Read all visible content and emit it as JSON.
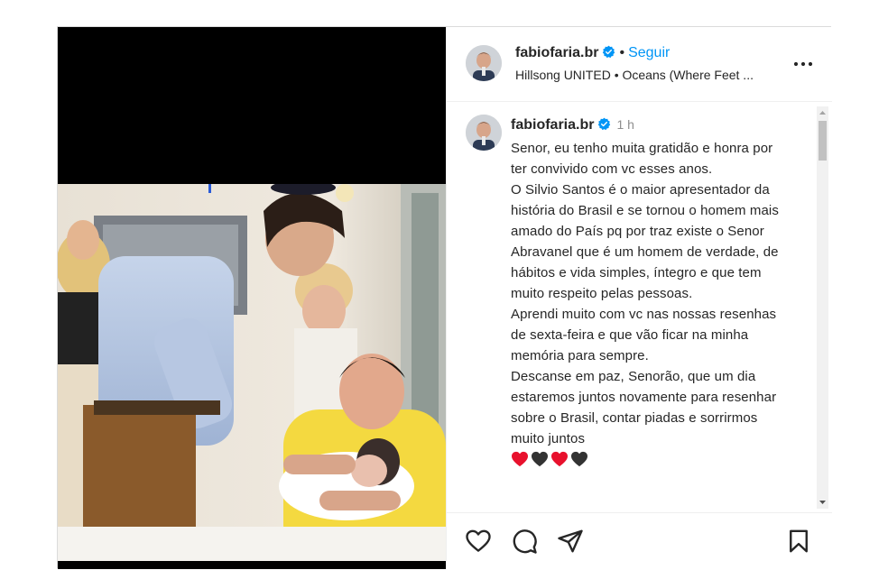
{
  "header": {
    "username": "fabiofaria.br",
    "separator": "•",
    "follow_label": "Seguir",
    "audio": "Hillsong UNITED • Oceans (Where Feet ...",
    "more_icon": "more-horizontal-icon"
  },
  "caption": {
    "username": "fabiofaria.br",
    "time": "1 h",
    "lines": [
      "Senor, eu tenho muita gratidão e honra por ter convivido com vc esses anos.",
      "O Silvio Santos é o maior apresentador da história do Brasil e se tornou o homem mais amado do País pq por traz existe o Senor Abravanel que é um homem de verdade, de hábitos e vida simples, íntegro e que tem muito respeito pelas pessoas.",
      "Aprendi muito com vc nas nossas resenhas de sexta-feira e que vão ficar na minha memória para sempre.",
      "Descanse em paz, Senorão, que um dia estaremos juntos novamente para resenhar sobre o Brasil, contar piadas e sorrirmos muito juntos"
    ],
    "hearts": [
      "red-heart-icon",
      "black-heart-icon",
      "red-heart-icon",
      "black-heart-icon"
    ]
  },
  "actions": {
    "like_icon": "heart-outline-icon",
    "comment_icon": "comment-icon",
    "share_icon": "share-icon",
    "save_icon": "bookmark-icon"
  },
  "colors": {
    "link": "#0095f6",
    "verified": "#0095f6",
    "heart_red": "#e8112d",
    "text": "#262626",
    "muted": "#8e8e8e"
  }
}
